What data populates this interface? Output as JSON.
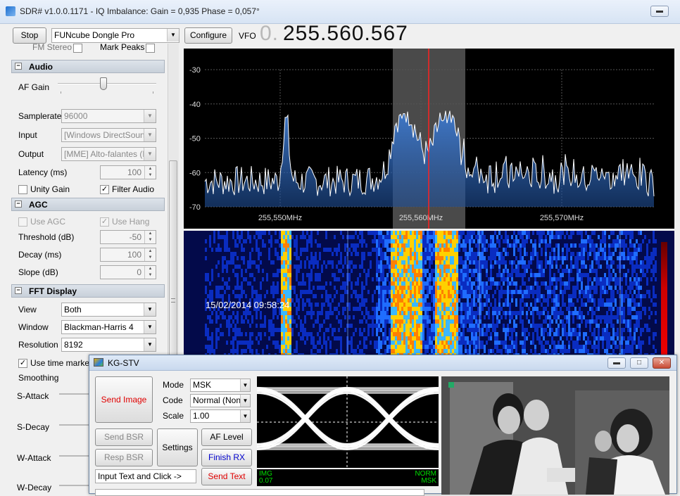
{
  "window": {
    "title": "SDR# v1.0.0.1171 - IQ Imbalance: Gain = 0,935 Phase = 0,057°"
  },
  "toolbar": {
    "stop_label": "Stop",
    "device": "FUNcube Dongle Pro",
    "configure_label": "Configure",
    "vfo_label": "VFO",
    "vfo_prefix": "0.",
    "vfo_value": "255.560.567"
  },
  "top_partial": {
    "fm_stereo": "FM Stereo",
    "mark_peaks": "Mark Peaks"
  },
  "audio": {
    "header": "Audio",
    "af_gain_label": "AF Gain",
    "af_gain_value": 0.48,
    "samplerate_label": "Samplerate",
    "samplerate": "96000",
    "input_label": "Input",
    "input": "[Windows DirectSound]",
    "output_label": "Output",
    "output": "[MME] Alto-falantes (Re",
    "latency_label": "Latency (ms)",
    "latency": "100",
    "unity_gain_label": "Unity Gain",
    "filter_audio_label": "Filter Audio"
  },
  "agc": {
    "header": "AGC",
    "use_agc_label": "Use AGC",
    "use_hang_label": "Use Hang",
    "threshold_label": "Threshold (dB)",
    "threshold": "-50",
    "decay_label": "Decay (ms)",
    "decay": "100",
    "slope_label": "Slope (dB)",
    "slope": "0"
  },
  "fft": {
    "header": "FFT Display",
    "view_label": "View",
    "view": "Both",
    "window_label": "Window",
    "window": "Blackman-Harris 4",
    "resolution_label": "Resolution",
    "resolution": "8192",
    "time_marker_label": "Use time marker",
    "smoothing_label": "Smoothing",
    "s_attack_label": "S-Attack",
    "s_decay_label": "S-Decay",
    "w_attack_label": "W-Attack",
    "w_decay_label": "W-Decay"
  },
  "spectrum": {
    "y_ticks": [
      "-30",
      "-40",
      "-50",
      "-60",
      "-70"
    ],
    "x_ticks": [
      "255,550MHz",
      "255,560MHz",
      "255,570MHz"
    ],
    "colors": {
      "trace": "#ffffff",
      "fill": "#1f4e96",
      "filter": "#4a4a4a",
      "tuning": "#ff2020"
    }
  },
  "waterfall": {
    "timestamp": "15/02/2014 09:58:24"
  },
  "kgstv": {
    "title": "KG-STV",
    "send_image_label": "Send Image",
    "mode_label": "Mode",
    "mode": "MSK",
    "code_label": "Code",
    "code": "Normal (Non)",
    "scale_label": "Scale",
    "scale": "1.00",
    "send_bsr_label": "Send BSR",
    "resp_bsr_label": "Resp BSR",
    "settings_label": "Settings",
    "af_level_label": "AF Level",
    "finish_rx_label": "Finish RX",
    "input_text_value": "Input Text and Click ->",
    "send_text_label": "Send Text",
    "status_img": "IMG",
    "status_value": "0.07",
    "status_norm": "NORM",
    "status_mode": "MSK",
    "colors": {
      "send_image": "#e00000",
      "finish_rx": "#0000cc",
      "send_text": "#e00000",
      "status_text": "#00e000"
    }
  }
}
